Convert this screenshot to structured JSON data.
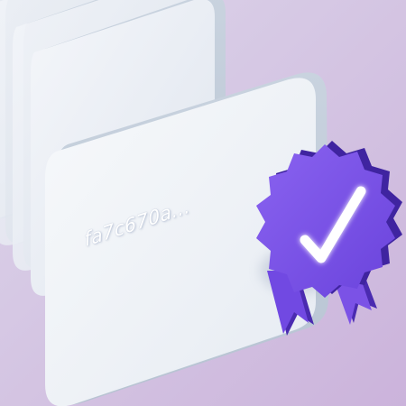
{
  "card": {
    "hash_text": "fa7c670a..."
  },
  "icons": {
    "badge": "verified-rosette-checkmark-icon"
  },
  "colors": {
    "background_top": "#d8d0e6",
    "background_bottom": "#cdb8dc",
    "card_face": "#f1f4f8",
    "badge_front": "#7b52e6",
    "badge_side": "#4a2bb0",
    "checkmark": "#ffffff"
  }
}
